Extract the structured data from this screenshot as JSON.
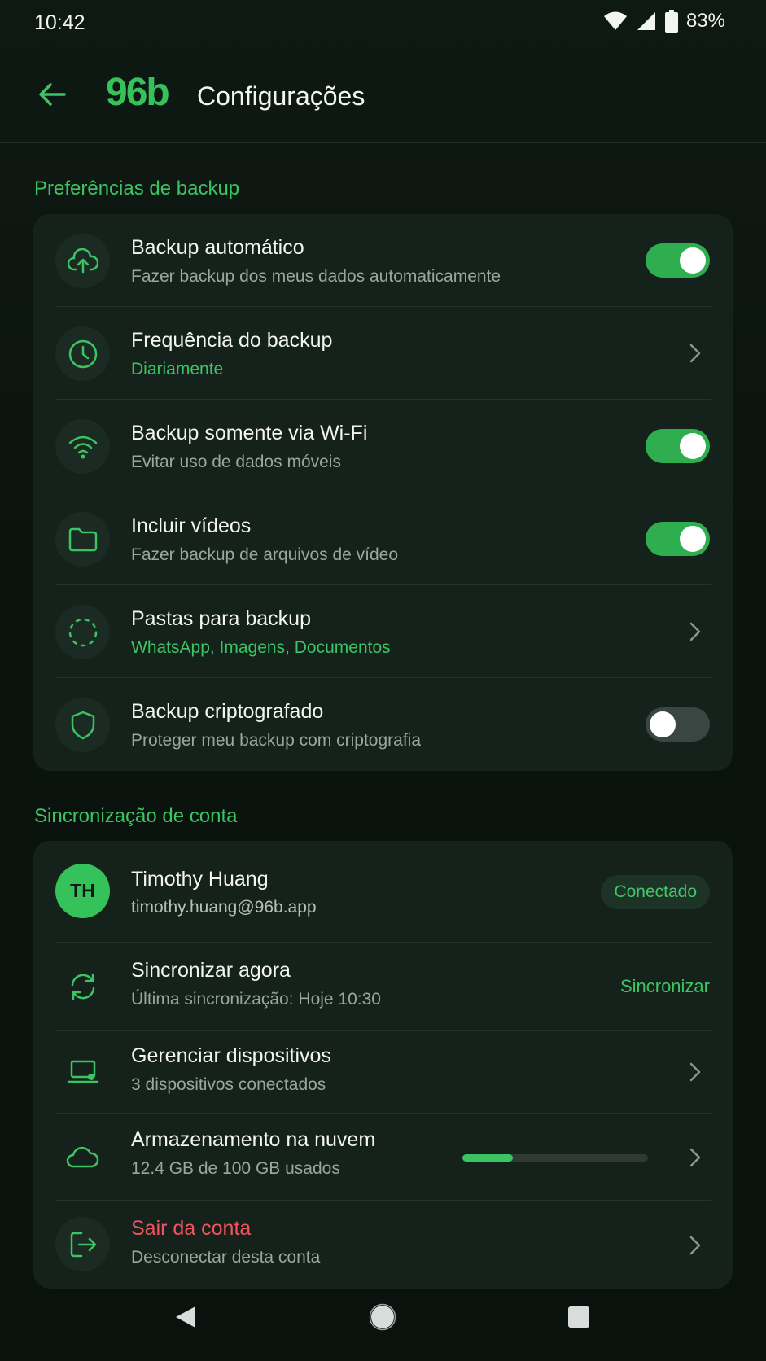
{
  "status_bar": {
    "time": "10:42",
    "battery": "83%"
  },
  "app_bar": {
    "logo": "96b",
    "title": "Configurações"
  },
  "colors": {
    "accent": "#3cc463",
    "danger": "#f0555f",
    "card": "#15211b",
    "background": "#0c1410"
  },
  "backup_section": {
    "title": "Preferências de backup",
    "items": [
      {
        "title": "Backup automático",
        "subtitle": "Fazer backup dos meus dados automaticamente",
        "icon": "cloud-upload-icon",
        "control": "toggle",
        "enabled": true
      },
      {
        "title": "Frequência do backup",
        "subtitle": "Diariamente",
        "icon": "clock-icon",
        "control": "chevron"
      },
      {
        "title": "Backup somente via Wi-Fi",
        "subtitle": "Evitar uso de dados móveis",
        "icon": "wifi-icon",
        "control": "toggle",
        "enabled": true
      },
      {
        "title": "Incluir vídeos",
        "subtitle": "Fazer backup de arquivos de vídeo",
        "icon": "folder-icon",
        "control": "toggle",
        "enabled": true
      },
      {
        "title": "Pastas para backup",
        "subtitle": "WhatsApp, Imagens, Documentos",
        "icon": "dashed-circle-icon",
        "control": "chevron"
      },
      {
        "title": "Backup criptografado",
        "subtitle": "Proteger meu backup com criptografia",
        "icon": "shield-icon",
        "control": "toggle",
        "enabled": false
      }
    ]
  },
  "sync_section": {
    "title": "Sincronização de conta",
    "account": {
      "initials": "TH",
      "name": "Timothy Huang",
      "email": "timothy.huang@96b.app",
      "status": "Conectado"
    },
    "sync_now": {
      "title": "Sincronizar agora",
      "subtitle": "Última sincronização: Hoje 10:30",
      "action": "Sincronizar",
      "icon": "sync-icon"
    },
    "devices": {
      "title": "Gerenciar dispositivos",
      "subtitle": "3 dispositivos conectados",
      "icon": "laptop-icon"
    },
    "storage": {
      "title": "Armazenamento na nuvem",
      "subtitle": "12.4 GB de 100 GB usados",
      "used_fraction": 0.27,
      "icon": "cloud-icon"
    },
    "logout": {
      "title": "Sair da conta",
      "subtitle": "Desconectar desta conta",
      "icon": "logout-icon"
    }
  },
  "nav_bar": {
    "icons": [
      "back-triangle-icon",
      "home-circle-icon",
      "recents-square-icon"
    ]
  }
}
